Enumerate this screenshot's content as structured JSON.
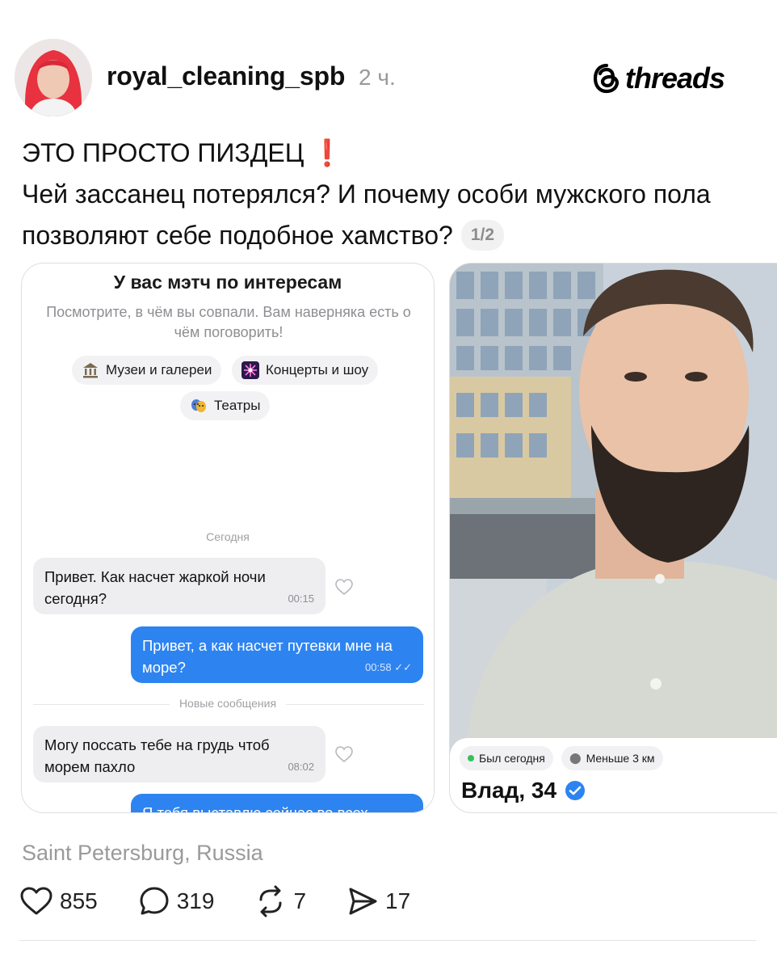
{
  "post": {
    "username": "royal_cleaning_spb",
    "time": "2 ч.",
    "brand": "threads",
    "line1": "ЭТО ПРОСТО ПИЗДЕЦ",
    "line1_emoji": "❗",
    "line2": "Чей зассанец потерялся? И почему особи мужского пола позволяют себе подобное хамство?",
    "page_indicator": "1/2",
    "location": "Saint Petersburg, Russia"
  },
  "chat_card": {
    "title": "У вас мэтч по интересам",
    "subtitle": "Посмотрите, в чём вы совпали. Вам наверняка есть о чём поговорить!",
    "chips": [
      {
        "label": "Музеи и галереи",
        "icon": "museum-icon"
      },
      {
        "label": "Концерты и шоу",
        "icon": "fireworks-icon"
      },
      {
        "label": "Театры",
        "icon": "theater-masks-icon"
      }
    ],
    "day_label": "Сегодня",
    "messages": [
      {
        "direction": "in",
        "text": "Привет. Как насчет жаркой ночи сегодня?",
        "time": "00:15"
      },
      {
        "direction": "out",
        "text": "Привет, а как насчет путевки мне на море?",
        "time": "00:58"
      },
      {
        "direction": "in",
        "text": "Могу поссать тебе на грудь чтоб морем пахло",
        "time": "08:02"
      },
      {
        "direction": "out",
        "text": "Я тебя выставлю сейчас во всех",
        "time": ""
      }
    ],
    "new_messages_label": "Новые сообщения"
  },
  "profile_card": {
    "status": "Был сегодня",
    "distance": "Меньше 3 км",
    "name_age": "Влад, 34"
  },
  "actions": {
    "likes": "855",
    "replies": "319",
    "reposts": "7",
    "shares": "17"
  },
  "colors": {
    "accent_blue": "#2d84f0",
    "alert_red": "#e0241f",
    "online_green": "#33c25b"
  }
}
